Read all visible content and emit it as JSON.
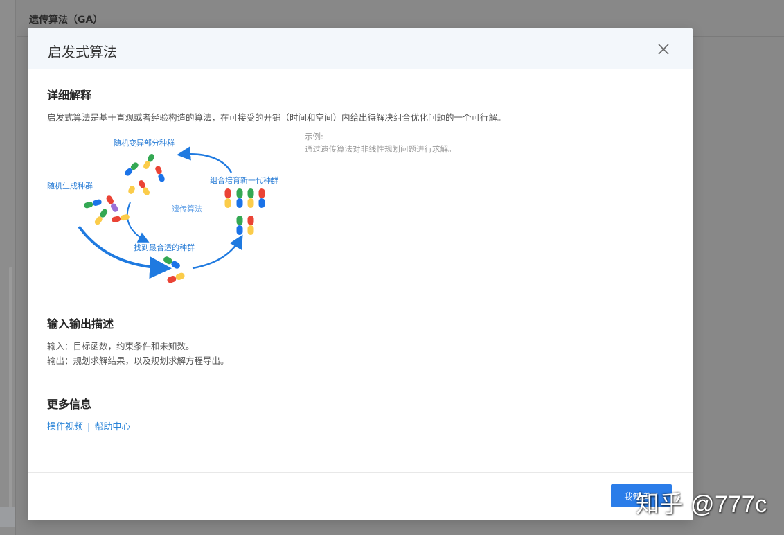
{
  "background": {
    "page_title": "遗传算法（GA）"
  },
  "modal": {
    "title": "启发式算法",
    "close_icon": "close-icon",
    "sections": {
      "explain": {
        "heading": "详细解释",
        "text": "启发式算法是基于直观或者经验构造的算法，在可接受的开销（时间和空间）内给出待解决组合优化问题的一个可行解。",
        "example_label": "示例:",
        "example_text": "通过遗传算法对非线性规划问题进行求解。"
      },
      "io": {
        "heading": "输入输出描述",
        "input": "输入：目标函数，约束条件和未知数。",
        "output": "输出：规划求解结果，以及规划求解方程导出。"
      },
      "more": {
        "heading": "更多信息",
        "link_video": "操作视频",
        "separator": "|",
        "link_help": "帮助中心"
      }
    },
    "diagram": {
      "center": "遗传算法",
      "label_random_pop": "随机生成种群",
      "label_mutate": "随机变异部分种群",
      "label_new_gen": "组合培育新一代种群",
      "label_best": "找到最合适的种群",
      "colors": {
        "blue": "#1b73e8",
        "green": "#34a853",
        "yellow": "#fbcc4a",
        "red": "#ea4335",
        "purple": "#9b6fd6",
        "arrow": "#1f7ae0"
      }
    },
    "footer": {
      "confirm_label": "我知道了"
    }
  },
  "watermark": "知乎 @777c"
}
